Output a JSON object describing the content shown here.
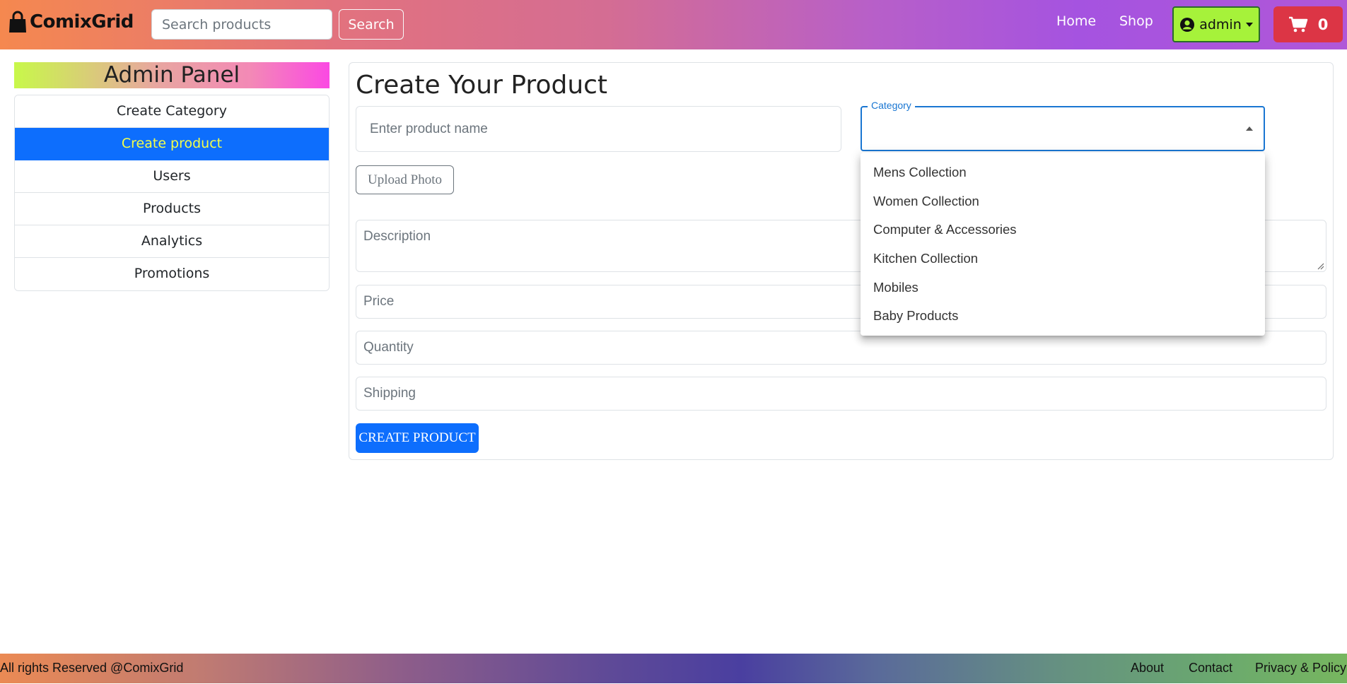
{
  "header": {
    "brand": "ComixGrid",
    "search_placeholder": "Search products",
    "search_button": "Search",
    "nav": {
      "home": "Home",
      "shop": "Shop"
    },
    "user_menu_label": "admin",
    "cart_count": "0"
  },
  "sidebar": {
    "title": "Admin Panel",
    "items": [
      {
        "label": "Create Category"
      },
      {
        "label": "Create product"
      },
      {
        "label": "Users"
      },
      {
        "label": "Products"
      },
      {
        "label": "Analytics"
      },
      {
        "label": "Promotions"
      }
    ]
  },
  "main": {
    "title": "Create Your Product",
    "product_name_placeholder": "Enter product name",
    "category_label": "Category",
    "category_options": [
      "Mens Collection",
      "Women Collection",
      "Computer & Accessories",
      "Kitchen Collection",
      "Mobiles",
      "Baby Products"
    ],
    "upload_button": "Upload Photo",
    "description_placeholder": "Description",
    "price_placeholder": "Price",
    "quantity_placeholder": "Quantity",
    "shipping_placeholder": "Shipping",
    "create_button": "CREATE PRODUCT"
  },
  "footer": {
    "copyright": "All rights Reserved @ComixGrid",
    "links": {
      "about": "About",
      "contact": "Contact",
      "privacy": "Privacy & Policy"
    }
  },
  "colors": {
    "primary": "#0d6efd",
    "active_text": "#f3ff4a",
    "cart": "#dc3545",
    "admin_button": "#a6f23a",
    "select_focus": "#1976d2"
  },
  "icons": {
    "brand": "shopping-bag-icon",
    "user": "user-circle-icon",
    "cart": "shopping-cart-icon"
  }
}
